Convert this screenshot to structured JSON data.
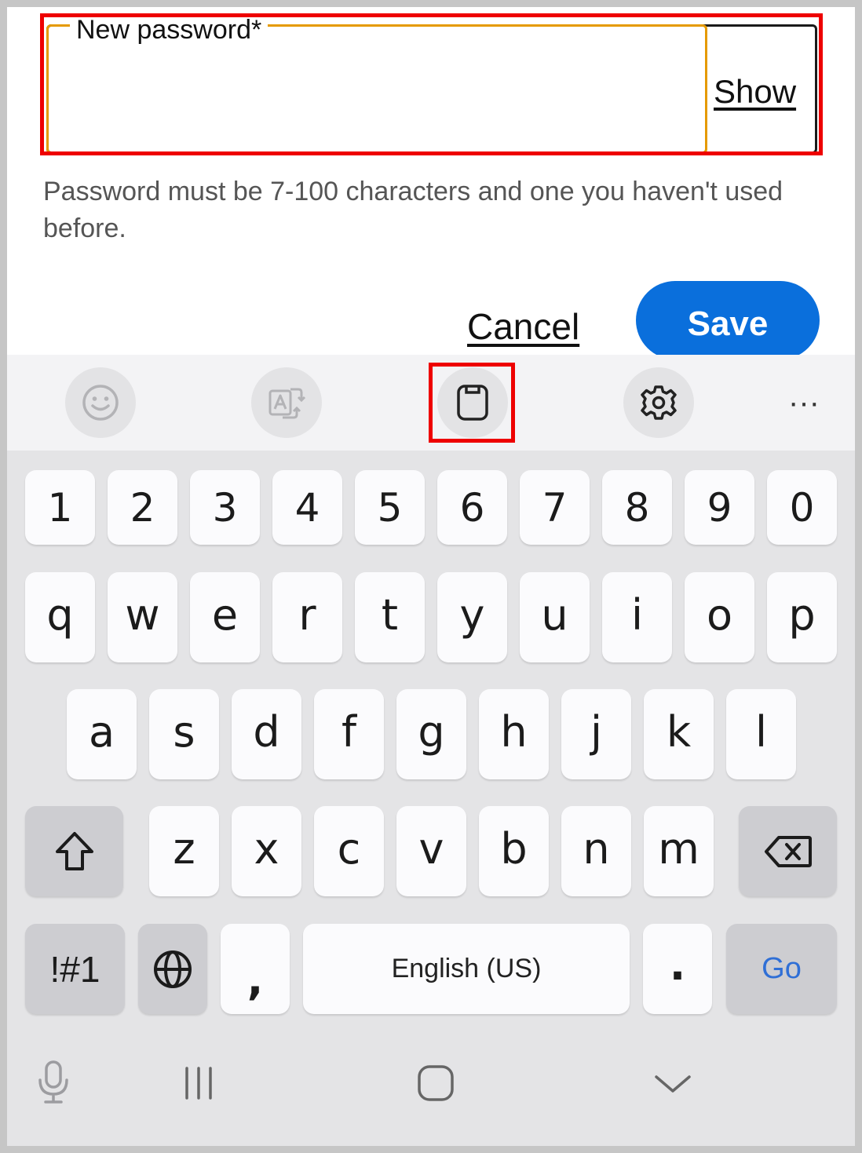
{
  "form": {
    "password_label": "New password*",
    "show_label": "Show",
    "hint": "Password must be 7-100 characters and one you haven't used before.",
    "cancel_label": "Cancel",
    "save_label": "Save"
  },
  "toolbar": {
    "items": [
      "emoji-icon",
      "translate-icon",
      "clipboard-icon",
      "settings-icon"
    ],
    "more_label": "···"
  },
  "keyboard": {
    "numbers": [
      "1",
      "2",
      "3",
      "4",
      "5",
      "6",
      "7",
      "8",
      "9",
      "0"
    ],
    "row1": [
      "q",
      "w",
      "e",
      "r",
      "t",
      "y",
      "u",
      "i",
      "o",
      "p"
    ],
    "row2": [
      "a",
      "s",
      "d",
      "f",
      "g",
      "h",
      "j",
      "k",
      "l"
    ],
    "row3": [
      "z",
      "x",
      "c",
      "v",
      "b",
      "n",
      "m"
    ],
    "symbols_label": "!#1",
    "comma_label": ",",
    "space_label": "English (US)",
    "period_label": ".",
    "go_label": "Go"
  },
  "colors": {
    "accent": "#0a6fdc",
    "field_focus": "#e59a00",
    "highlight": "#ee0000",
    "go_text": "#2f6fd6"
  }
}
